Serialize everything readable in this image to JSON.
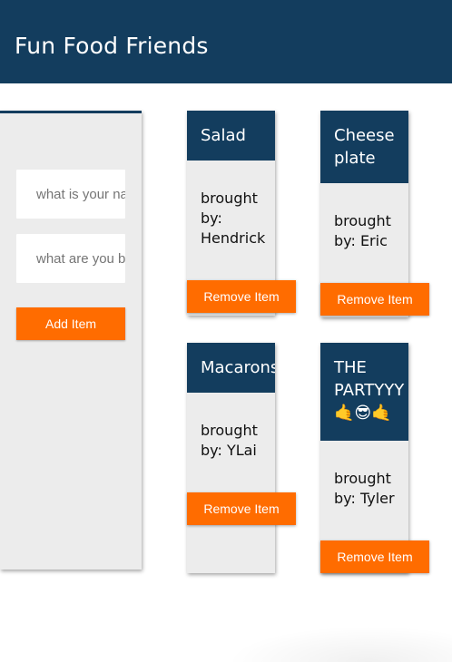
{
  "header": {
    "title": "Fun Food Friends"
  },
  "form": {
    "name_placeholder": "what is your name?",
    "item_placeholder": "what are you bringing?",
    "add_label": "Add Item"
  },
  "cards": [
    {
      "title": "Salad",
      "brought_by": "brought by: Hendrick",
      "remove_label": "Remove Item"
    },
    {
      "title": "Cheese plate",
      "brought_by": "brought by: Eric",
      "remove_label": "Remove Item"
    },
    {
      "title": "Macarons",
      "brought_by": "brought by: YLai",
      "remove_label": "Remove Item"
    },
    {
      "title": "THE PARTYYY 🤙😎🤙",
      "brought_by": "brought by: Tyler",
      "remove_label": "Remove Item"
    }
  ],
  "colors": {
    "header_bg": "#133d5e",
    "button_bg": "#ff6c00",
    "panel_bg": "#ececec"
  }
}
